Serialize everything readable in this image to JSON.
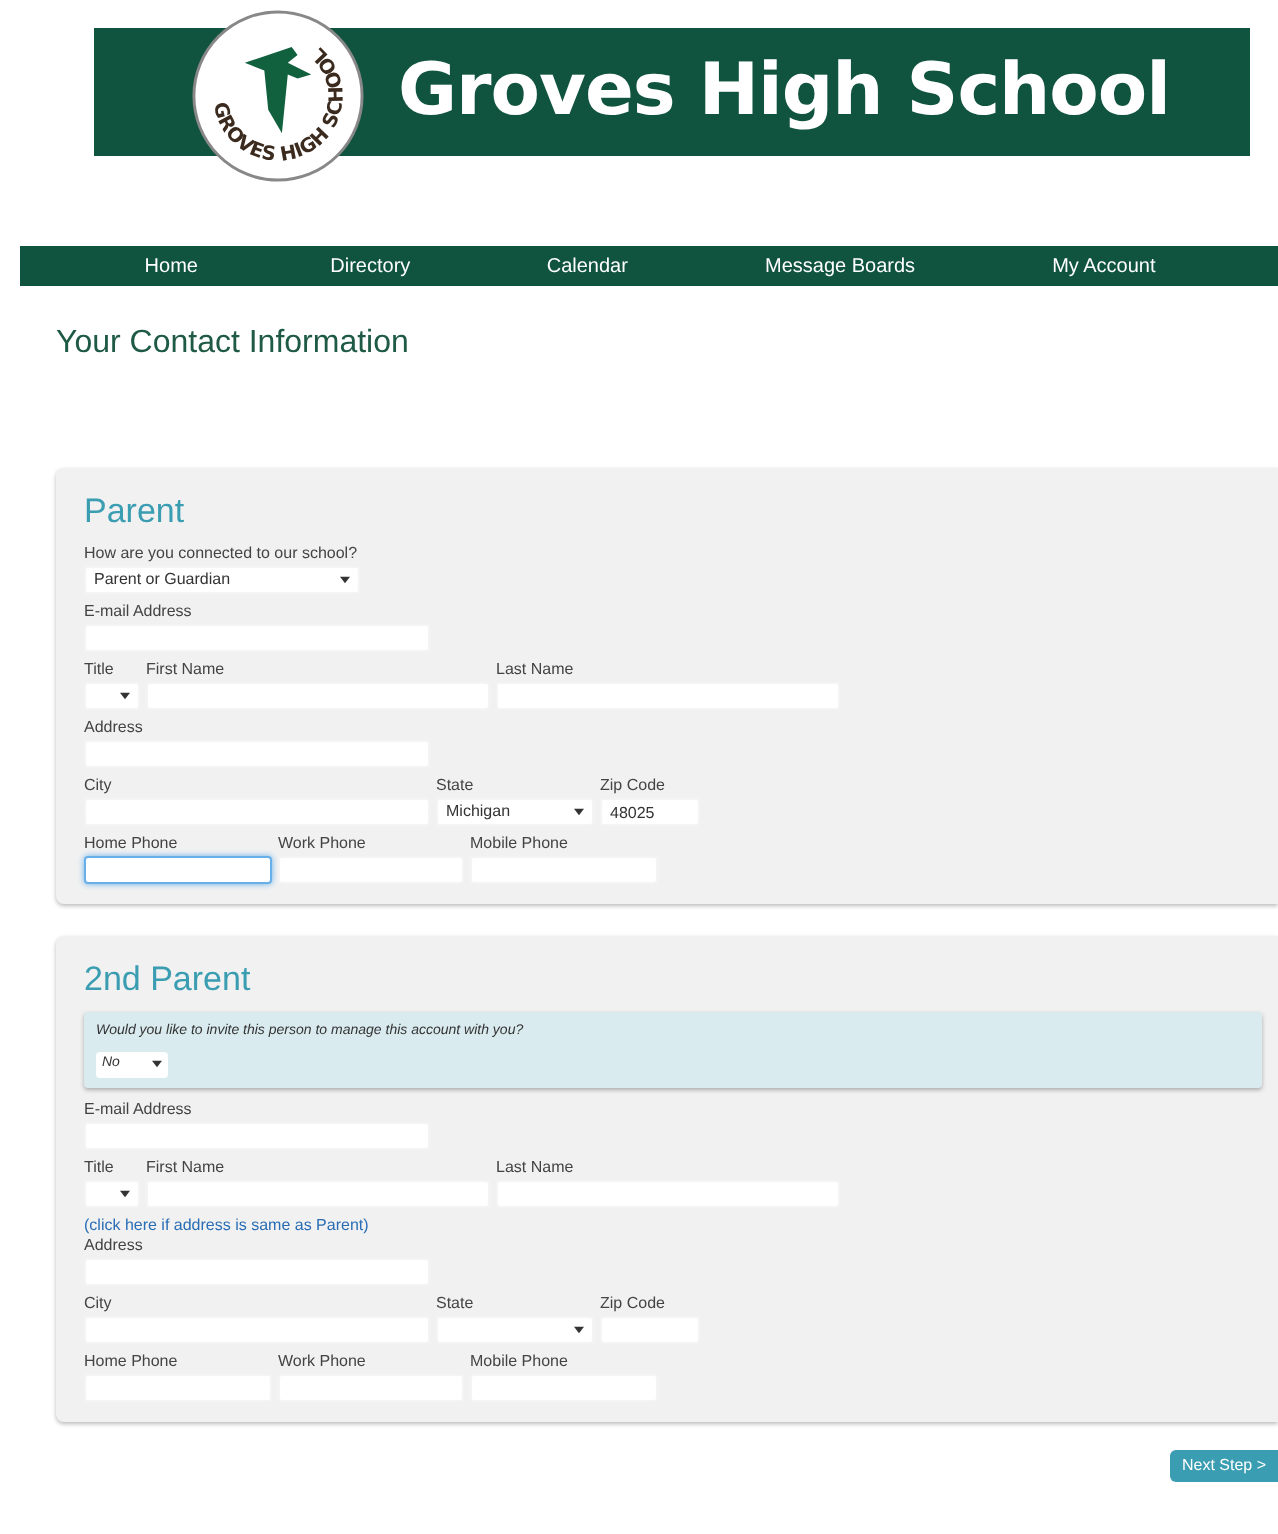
{
  "header": {
    "logo_text": "GROVES HIGH SCHOOL",
    "title": "Groves High School"
  },
  "nav": [
    {
      "label": "Home"
    },
    {
      "label": "Directory"
    },
    {
      "label": "Calendar"
    },
    {
      "label": "Message Boards"
    },
    {
      "label": "My Account"
    }
  ],
  "page_title": "Your Contact Information",
  "sections": [
    {
      "title": "Parent",
      "rows": [
        {
          "kind": "connection",
          "fields": [
            {
              "kind": "select",
              "label": "How are you connected to our school?",
              "value": "Parent or Guardian"
            }
          ]
        },
        {
          "kind": "email",
          "fields": [
            {
              "kind": "input",
              "label": "E-mail Address",
              "focused": false
            }
          ]
        },
        {
          "kind": "name",
          "fields": [
            {
              "kind": "select",
              "label": "Title"
            },
            {
              "kind": "input",
              "label": "First Name",
              "focused": false
            },
            {
              "kind": "input",
              "label": "Last Name",
              "focused": false
            }
          ]
        },
        {
          "kind": "address",
          "fields": [
            {
              "kind": "input",
              "label": "Address",
              "focused": false
            }
          ]
        },
        {
          "kind": "city",
          "fields": [
            {
              "kind": "input",
              "label": "City",
              "focused": false
            },
            {
              "kind": "select",
              "label": "State",
              "value": "Michigan"
            },
            {
              "kind": "input",
              "label": "Zip Code",
              "value": "48025",
              "focused": false
            }
          ]
        },
        {
          "kind": "phones",
          "fields": [
            {
              "kind": "input",
              "label": "Home Phone",
              "focused": true
            },
            {
              "kind": "input",
              "label": "Work Phone",
              "focused": false
            },
            {
              "kind": "input",
              "label": "Mobile Phone",
              "focused": false
            }
          ]
        }
      ]
    },
    {
      "title": "2nd Parent",
      "invite": {
        "question": "Would you like to invite this person to manage this account with you?",
        "value": "No"
      },
      "rows": [
        {
          "kind": "email",
          "fields": [
            {
              "kind": "input",
              "label": "E-mail Address",
              "focused": false
            }
          ]
        },
        {
          "kind": "name",
          "fields": [
            {
              "kind": "select",
              "label": "Title"
            },
            {
              "kind": "input",
              "label": "First Name",
              "focused": false
            },
            {
              "kind": "input",
              "label": "Last Name",
              "focused": false
            }
          ]
        },
        {
          "kind": "address",
          "link": "(click here if address is same as Parent)",
          "fields": [
            {
              "kind": "input",
              "label": "Address",
              "focused": false
            }
          ]
        },
        {
          "kind": "city",
          "fields": [
            {
              "kind": "input",
              "label": "City",
              "focused": false
            },
            {
              "kind": "select",
              "label": "State"
            },
            {
              "kind": "input",
              "label": "Zip Code",
              "focused": false
            }
          ]
        },
        {
          "kind": "phones",
          "fields": [
            {
              "kind": "input",
              "label": "Home Phone",
              "focused": false
            },
            {
              "kind": "input",
              "label": "Work Phone",
              "focused": false
            },
            {
              "kind": "input",
              "label": "Mobile Phone",
              "focused": false
            }
          ]
        }
      ]
    }
  ],
  "next_button": "Next Step >"
}
